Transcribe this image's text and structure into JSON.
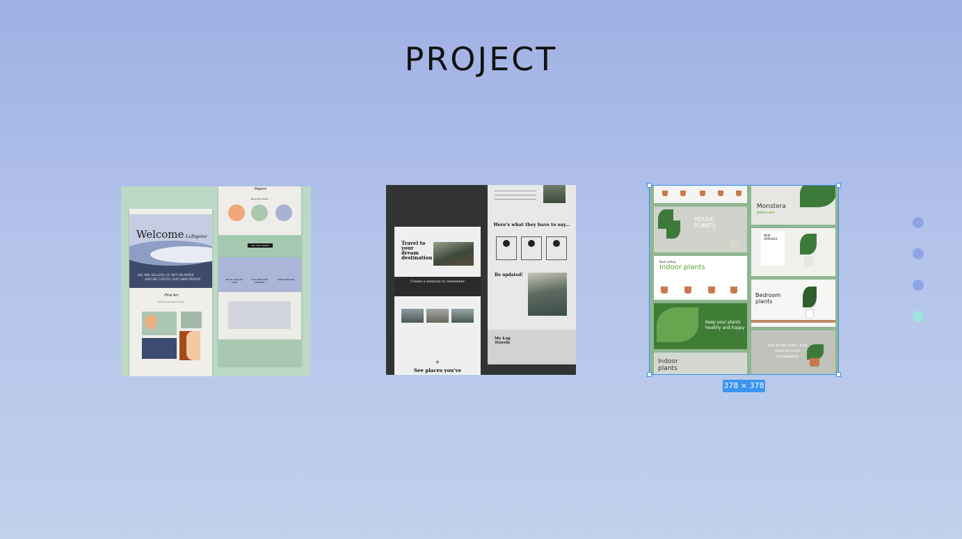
{
  "page": {
    "title": "PROJECT"
  },
  "selection": {
    "size_label": "378 × 378"
  },
  "pager": {
    "count": 4,
    "active_index": 3,
    "colors": {
      "inactive": "#8da4e6",
      "active": "#9ee6dd"
    }
  },
  "card1": {
    "welcome": "Welcome",
    "brand": "–LePapeler",
    "tagline_1": "WE ARE SELLERS OF ART ON PAPER",
    "tagline_2": "AND WE CREATE OUR OWN PAPERS",
    "fine_art": "–Fine Art",
    "fine_art_sub": "Some Lorem Ipsum Here",
    "papers": "–Papers",
    "papers_sub": "Recycled version",
    "ask_sample": "ASK FOR SAMPLE",
    "features": [
      "PAY BY CARD OR CASH",
      "FAST AND SAFE SHIPPING",
      "SAFE PURCHASE"
    ]
  },
  "card2": {
    "travel": "Travel to your dream destination",
    "memory": "Create a memory to remember",
    "plus": "+",
    "places": "See places you've",
    "here": "Here's what they have to say...",
    "updated": "Be updated!",
    "footer_logo": "My Log Travels"
  },
  "card3": {
    "house_plants": "HOUSE PLANTS",
    "monstera": "Monstera",
    "monstera_sub": "plant care",
    "new_arrivals": "NEW ARRIVALS",
    "best_selling": "Best selling",
    "indoor_plants": "Indoor plants",
    "keep_happy": "Keep your plants healthy and happy",
    "bedroom": "Bedroom plants",
    "indoor_plants_2": "Indoor plants",
    "life_short": "Life is too short, buy more & more houseplants",
    "colors": {
      "green_heading": "#5aa02c",
      "panel": "#8fb690"
    }
  }
}
